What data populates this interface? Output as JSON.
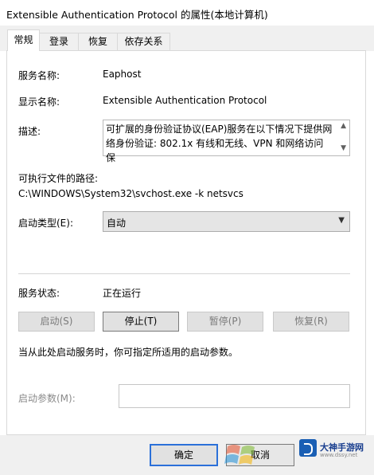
{
  "window": {
    "title": "Extensible Authentication Protocol 的属性(本地计算机)"
  },
  "tabs": [
    {
      "label": "常规",
      "active": true
    },
    {
      "label": "登录",
      "active": false
    },
    {
      "label": "恢复",
      "active": false
    },
    {
      "label": "依存关系",
      "active": false
    }
  ],
  "general": {
    "service_name_label": "服务名称:",
    "service_name": "Eaphost",
    "display_name_label": "显示名称:",
    "display_name": "Extensible Authentication Protocol",
    "description_label": "描述:",
    "description_line1": "可扩展的身份验证协议(EAP)服务在以下情况下提供网",
    "description_line2": "络身份验证: 802.1x 有线和无线、VPN 和网络访问保",
    "exe_path_label": "可执行文件的路径:",
    "exe_path": "C:\\WINDOWS\\System32\\svchost.exe -k netsvcs",
    "startup_type_label": "启动类型(E):",
    "startup_type_value": "自动",
    "service_status_label": "服务状态:",
    "service_status_value": "正在运行",
    "start_button": "启动(S)",
    "stop_button": "停止(T)",
    "pause_button": "暂停(P)",
    "resume_button": "恢复(R)",
    "hint_text": "当从此处启动服务时，你可指定所适用的启动参数。",
    "start_params_label": "启动参数(M):",
    "start_params_value": ""
  },
  "footer": {
    "ok_button": "确定",
    "cancel_button": "取消"
  },
  "watermark": {
    "brand_name": "大神手游网",
    "brand_url": "www.dssy.net"
  }
}
